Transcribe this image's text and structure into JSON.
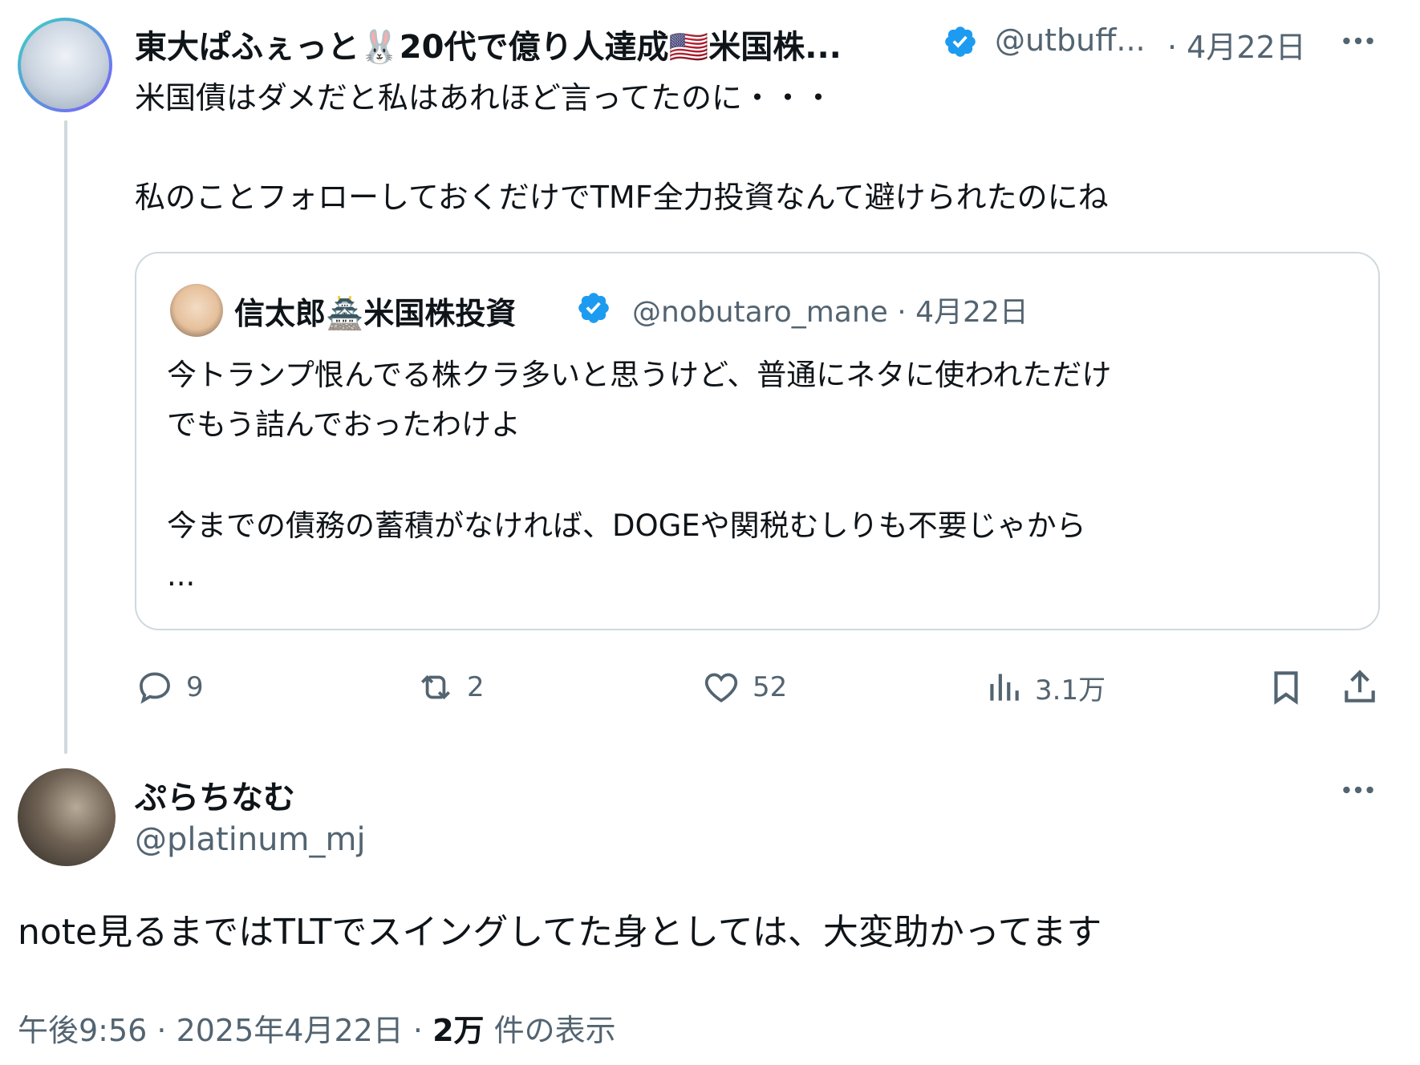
{
  "tweet": {
    "display_name": "東大ぱふぇっと🐰20代で億り人達成🇺🇸米国株...",
    "handle": "@utbuff...",
    "date": "· 4月22日",
    "lines": [
      "米国債はダメだと私はあれほど言ってたのに・・・",
      "私のことフォローしておくだけでTMF全力投資なんて避けられたのにね"
    ],
    "quote": {
      "display_name": "信太郎🏯米国株投資",
      "handle_date": "@nobutaro_mane · 4月22日",
      "lines": [
        "今トランプ恨んでる株クラ多いと思うけど、普通にネタに使われただけ",
        "でもう詰んでおったわけよ",
        "今までの債務の蓄積がなければ、DOGEや関税むしりも不要じゃから",
        "..."
      ]
    },
    "actions": {
      "reply_count": "9",
      "retweet_count": "2",
      "like_count": "52",
      "view_count": "3.1万"
    }
  },
  "reply": {
    "display_name": "ぷらちなむ",
    "handle": "@platinum_mj",
    "text": "note見るまではTLTでスイングしてた身としては、大変助かってます",
    "timestamp": "午後9:56 · 2025年4月22日 ·",
    "views_number": "2万",
    "views_label": "件の表示"
  },
  "colors": {
    "verified": "#1d9bf0",
    "muted": "#536471",
    "border": "#cfd9de"
  },
  "icons": [
    "verified-badge-icon",
    "more-icon",
    "reply-icon",
    "retweet-icon",
    "like-icon",
    "views-icon",
    "bookmark-icon",
    "share-icon"
  ]
}
